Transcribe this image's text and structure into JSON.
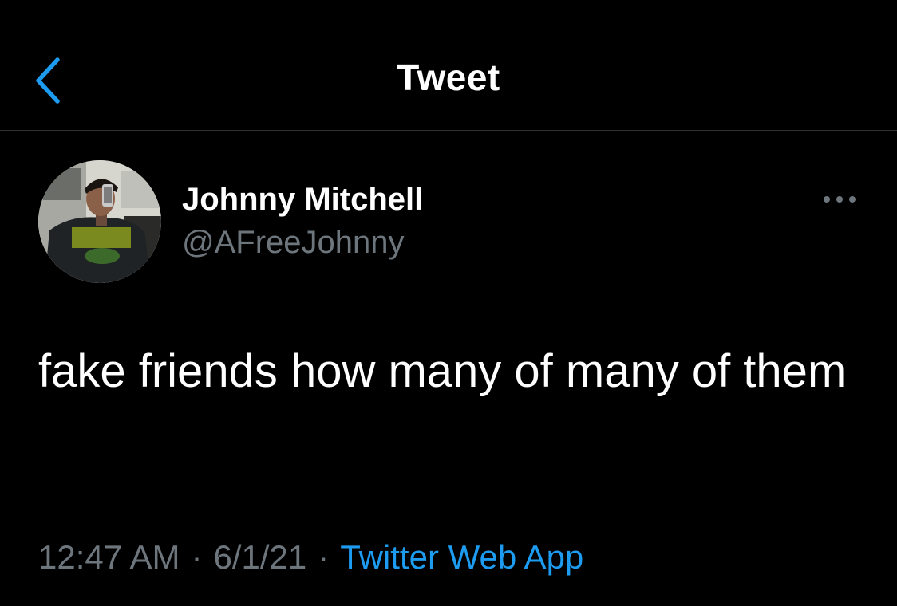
{
  "header": {
    "title": "Tweet",
    "back_icon": "chevron-left-icon",
    "accent_color": "#1d9bf0"
  },
  "tweet": {
    "author": {
      "display_name": "Johnny Mitchell",
      "handle": "@AFreeJohnny",
      "avatar": "profile-photo"
    },
    "more_icon": "ellipsis-icon",
    "text": "fake friends how many of many of them",
    "time": "12:47 AM",
    "separator": "·",
    "date": "6/1/21",
    "source": "Twitter Web App"
  },
  "colors": {
    "background": "#000000",
    "text": "#ffffff",
    "secondary_text": "#6e767d",
    "divider": "#2f3336",
    "link": "#1d9bf0"
  }
}
